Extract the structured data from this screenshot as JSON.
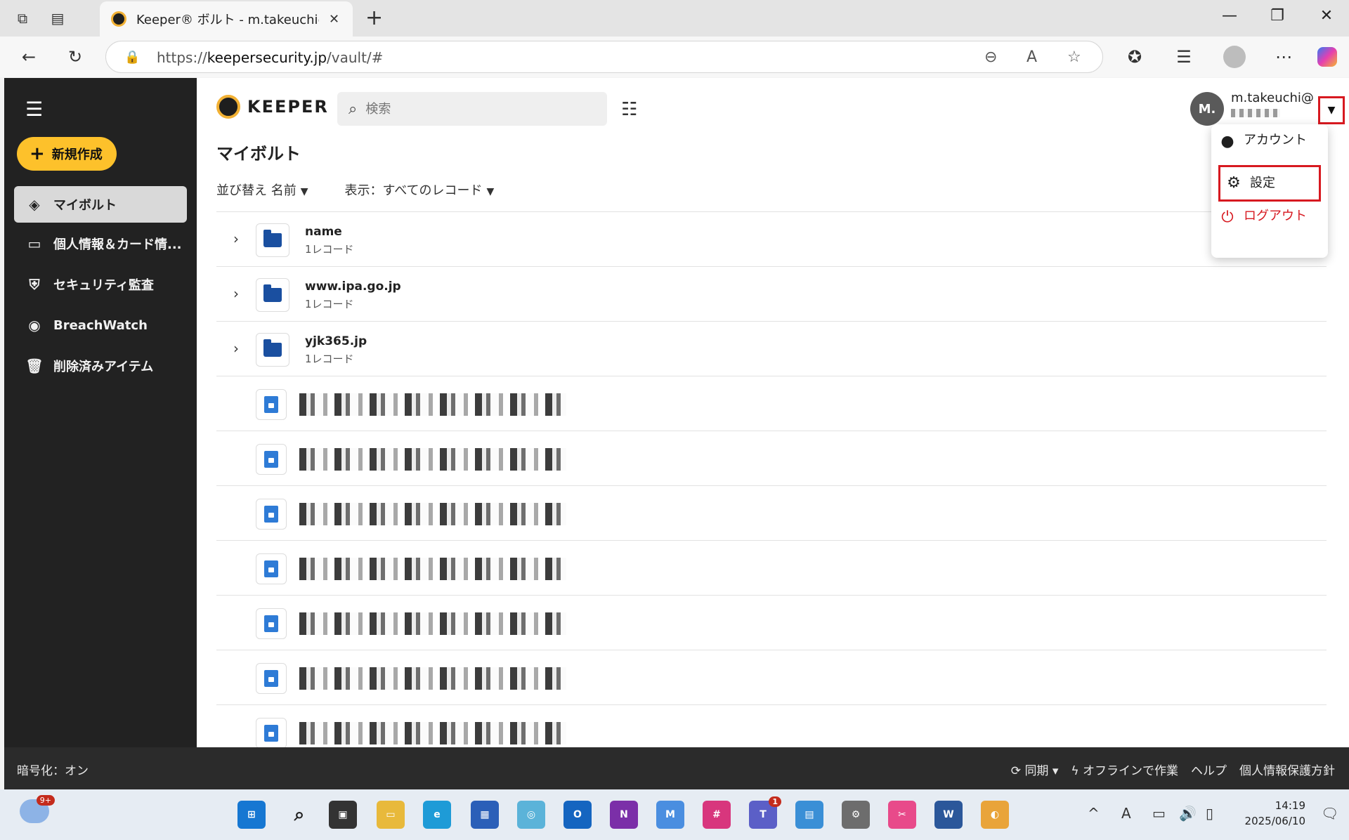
{
  "browser": {
    "tab_title": "Keeper® ボルト - m.takeuchi@",
    "url_host": "keepersecurity.jp",
    "url_prefix": "https://",
    "url_path": "/vault/#"
  },
  "app": {
    "logo_text": "KEEPER",
    "search_placeholder": "検索",
    "new_button": "新規作成",
    "page_title": "マイボルト",
    "sort_label": "並び替え 名前",
    "view_label": "表示：すべてのレコード",
    "sidebar": [
      {
        "label": "マイボルト",
        "icon": "vault-icon"
      },
      {
        "label": "個人情報＆カード情...",
        "icon": "card-icon"
      },
      {
        "label": "セキュリティ監査",
        "icon": "shield-icon"
      },
      {
        "label": "BreachWatch",
        "icon": "breachwatch-icon"
      },
      {
        "label": "削除済みアイテム",
        "icon": "trash-icon"
      }
    ],
    "folders": [
      {
        "name": "name",
        "count": "1レコード"
      },
      {
        "name": "www.ipa.go.jp",
        "count": "1レコード"
      },
      {
        "name": "yjk365.jp",
        "count": "1レコード"
      }
    ],
    "record_count": 7,
    "user": {
      "initials": "M.",
      "email": "m.takeuchi@"
    },
    "user_menu": {
      "account": "アカウント",
      "settings": "設定",
      "logout": "ログアウト"
    },
    "status": {
      "encryption": "暗号化：オン",
      "sync": "同期",
      "offline": "オフラインで作業",
      "help": "ヘルプ",
      "privacy": "個人情報保護方針"
    }
  },
  "taskbar": {
    "weather_badge": "9+",
    "teams_badge": "1",
    "time": "14:19",
    "date": "2025/06/10"
  },
  "colors": {
    "accent_yellow": "#fdc12b",
    "sidebar_bg": "#222222",
    "highlight_red": "#d71920",
    "folder_blue": "#1a4fa0"
  }
}
